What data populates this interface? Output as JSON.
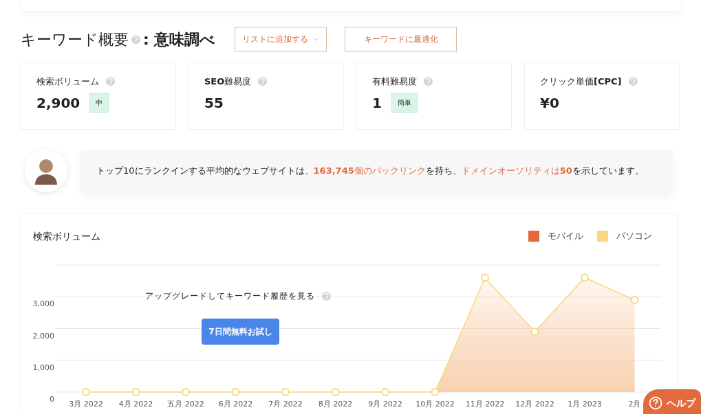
{
  "header": {
    "title": "キーワード概要",
    "keyword": ": 意味調べ",
    "add_to_list": "リストに追加する",
    "optimize": "キーワードに最適化"
  },
  "metrics": [
    {
      "label": "検索ボリューム",
      "value": "2,900",
      "badge": "中"
    },
    {
      "label": "**SEO**難易度",
      "value": "55"
    },
    {
      "label": "有料難易度",
      "value": "1",
      "badge": "簡単"
    },
    {
      "label": "クリック単価**[CPC]**",
      "value": "¥0"
    }
  ],
  "insight": [
    {
      "kind": "text",
      "text": "トップ10にランクインする平均的なウェブサイトは、"
    },
    {
      "kind": "link",
      "text": "**163,745**個のバックリンク"
    },
    {
      "kind": "text",
      "text": "を持ち、"
    },
    {
      "kind": "link",
      "text": "ドメインオーソリティは**50**"
    },
    {
      "kind": "text",
      "text": "を示しています。"
    }
  ],
  "volume_chart": {
    "title": "検索ボリューム",
    "upgrade_text": "アップグレードしてキーワード履歴を見る",
    "trial_button": "7日間無料お試し",
    "chart_data": {
      "type": "area",
      "categories": [
        "3月 2022",
        "4月 2022",
        "五月 2022",
        "6月 2022",
        "7月 2022",
        "8月 2022",
        "9月 2022",
        "10月 2022",
        "11月 2022",
        "12月 2022",
        "1月 2023",
        "2月"
      ],
      "series": [
        {
          "name": "モバイル",
          "color": "#e36a3c",
          "values": [
            null,
            null,
            null,
            null,
            null,
            null,
            null,
            null,
            null,
            null,
            null,
            null
          ]
        },
        {
          "name": "パソコン",
          "color": "#fad77e",
          "values": [
            0,
            0,
            0,
            0,
            0,
            0,
            0,
            0,
            3600,
            1900,
            3600,
            2900
          ]
        }
      ],
      "grid": true,
      "ylim": [
        0,
        4000
      ],
      "yticks": [
        {
          "value": 0,
          "label": "0"
        },
        {
          "value": 1000,
          "label": "1,000"
        },
        {
          "value": 2000,
          "label": "2,000"
        },
        {
          "value": 3000,
          "label": "3,000"
        }
      ]
    }
  },
  "help_button": "ヘルプ"
}
